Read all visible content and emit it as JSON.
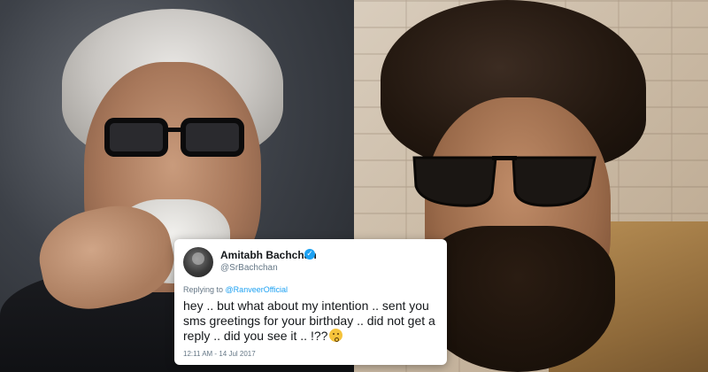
{
  "tweet": {
    "display_name": "Amitabh Bachchan",
    "handle": "@SrBachchan",
    "replying_prefix": "Replying to",
    "replying_mention": "@RanveerOfficial",
    "text": "hey .. but what about my intention .. sent you sms greetings for your birthday .. did not get a reply .. did you see it .. !??",
    "timestamp": "12:11 AM - 14 Jul 2017",
    "verified_icon": "verified-badge",
    "emoji": "kissing-face",
    "accent_color": "#1da1f2"
  },
  "photos": {
    "left": "portrait of older man with white hair, beard and dark glasses",
    "right": "portrait of man with dark hair, beard, sunglasses and tan jacket"
  }
}
